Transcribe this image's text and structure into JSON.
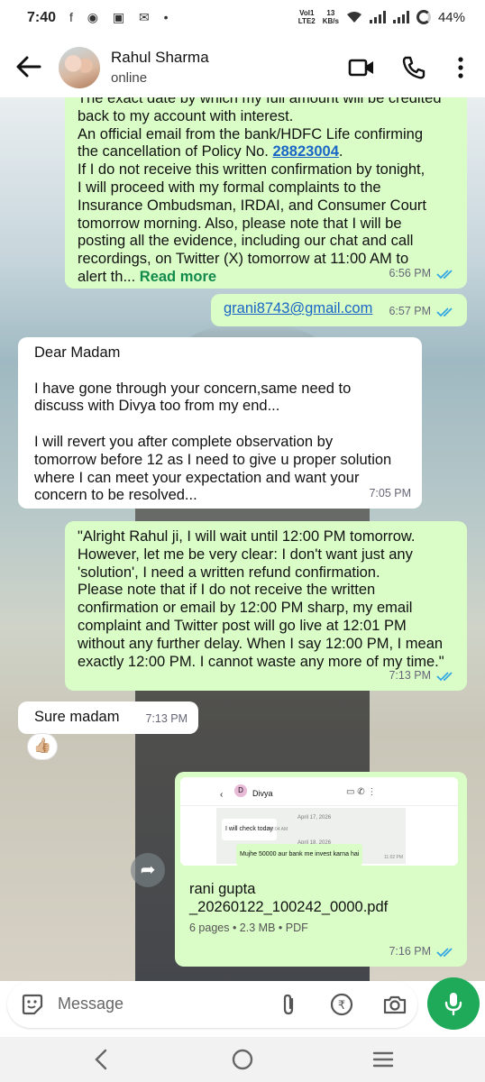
{
  "status_bar": {
    "time": "7:40",
    "app_icons": "f ◉ ▣ ✉ •",
    "network_top": "Vol1",
    "network_bottom": "LTE2",
    "speed_top": "13",
    "speed_bottom": "KB/s",
    "battery": "44%"
  },
  "header": {
    "contact_name": "Rahul Sharma",
    "status": "online",
    "icons": [
      "back-arrow-icon",
      "video-call-icon",
      "phone-icon",
      "more-vert-icon"
    ]
  },
  "messages": [
    {
      "line0": "The exact date by which my full amount will be credited",
      "text_before": "back to my account with interest.\nAn official email from the bank/HDFC Life confirming\nthe cancellation of Policy No. ",
      "link": "28823004",
      "text_after": ".\nIf I do not receive this written confirmation by tonight,\nI will proceed with my formal complaints to the\nInsurance Ombudsman, IRDAI, and Consumer Court\ntomorrow morning. Also, please note that I will be\nposting all the evidence, including our chat and call\nrecordings, on Twitter (X) tomorrow at 11:00 AM to\nalert th... ",
      "read_more": "Read more",
      "time": "6:56 PM"
    },
    {
      "email": "grani8743@gmail.com",
      "time": "6:57 PM"
    },
    {
      "text": "Dear Madam\n\nI have gone through your concern,same need to\ndiscuss with Divya too from my end...\n\nI will revert you after complete observation by\ntomorrow before 12 as I need to give u proper solution\nwhere I can meet your expectation and want your\nconcern to be resolved...",
      "time": "7:05 PM"
    },
    {
      "text": "\"Alright Rahul ji, I will wait until 12:00 PM tomorrow.\nHowever, let me be very clear: I don't want just any\n'solution', I need a written refund confirmation.\nPlease note that if I do not receive the written\nconfirmation or email by 12:00 PM sharp, my email\ncomplaint and Twitter post will go live at 12:01 PM\nwithout any further delay. When I say 12:00 PM, I mean\nexactly 12:00 PM. I cannot waste any more of my time.\"",
      "time": "7:13 PM"
    },
    {
      "text": "Sure madam",
      "time": "7:13 PM",
      "reaction": "👍🏼"
    },
    {
      "doc_name": "rani gupta\n_20260122_100242_0000.pdf",
      "doc_meta": "6 pages • 2.3 MB • PDF",
      "time": "7:16 PM",
      "thumb": {
        "contact": "Divya",
        "date1": "April 17, 2026",
        "msg1": "I will check today",
        "msg1_time": "12:04 AM",
        "date2": "April 18, 2026",
        "msg2": "Mujhe 50000 aur bank me invest karna hai",
        "msg2_time": "11:02 PM"
      }
    }
  ],
  "composer": {
    "placeholder": "Message"
  },
  "colors": {
    "outgoing_bubble": "#dafdc7",
    "incoming_bubble": "#ffffff",
    "read_ticks": "#34a8e3",
    "link": "#1a66c6",
    "read_more": "#128a4c",
    "mic_button": "#1faa59"
  }
}
